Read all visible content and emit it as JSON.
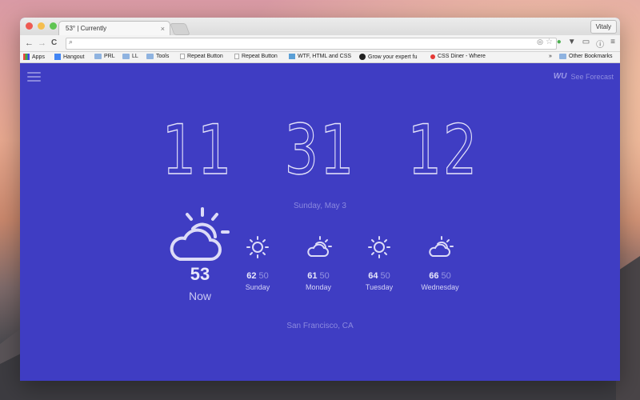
{
  "window": {
    "tab_title": "53° | Currently",
    "tab_close": "×",
    "user_button": "Vitaly"
  },
  "toolbar": {
    "back": "←",
    "forward": "→",
    "reload": "C",
    "search_glyph": "⌕",
    "address_value": "",
    "star": "☆"
  },
  "bookmarks": [
    {
      "label": "Apps",
      "kind": "apps"
    },
    {
      "label": "Hangout",
      "kind": "g"
    },
    {
      "label": "PRL",
      "kind": "folder"
    },
    {
      "label": "LL",
      "kind": "folder"
    },
    {
      "label": "Tools",
      "kind": "folder"
    },
    {
      "label": "Repeat Button",
      "kind": "page"
    },
    {
      "label": "Repeat Button",
      "kind": "page"
    },
    {
      "label": "WTF, HTML and CSS",
      "kind": "ltr"
    },
    {
      "label": "Grow your expert fu",
      "kind": "exc"
    },
    {
      "label": "CSS Diner - Where",
      "kind": "dot"
    }
  ],
  "bookmarks_more": "»",
  "bookmarks_other": "Other Bookmarks",
  "app": {
    "brand": "WU",
    "see_forecast": "See Forecast",
    "clock": {
      "hours": "11",
      "minutes": "31",
      "seconds": "12"
    },
    "date": "Sunday, May 3",
    "now": {
      "temp": "53",
      "label": "Now",
      "icon": "partly-cloudy-icon"
    },
    "forecast": [
      {
        "hi": "62",
        "lo": "50",
        "day": "Sunday",
        "icon": "sun-icon"
      },
      {
        "hi": "61",
        "lo": "50",
        "day": "Monday",
        "icon": "partly-cloudy-icon"
      },
      {
        "hi": "64",
        "lo": "50",
        "day": "Tuesday",
        "icon": "sun-icon"
      },
      {
        "hi": "66",
        "lo": "50",
        "day": "Wednesday",
        "icon": "partly-cloudy-icon"
      }
    ],
    "location": "San Francisco, CA"
  },
  "colors": {
    "background": "#3f3dc3",
    "accent_text": "#8b89df"
  }
}
